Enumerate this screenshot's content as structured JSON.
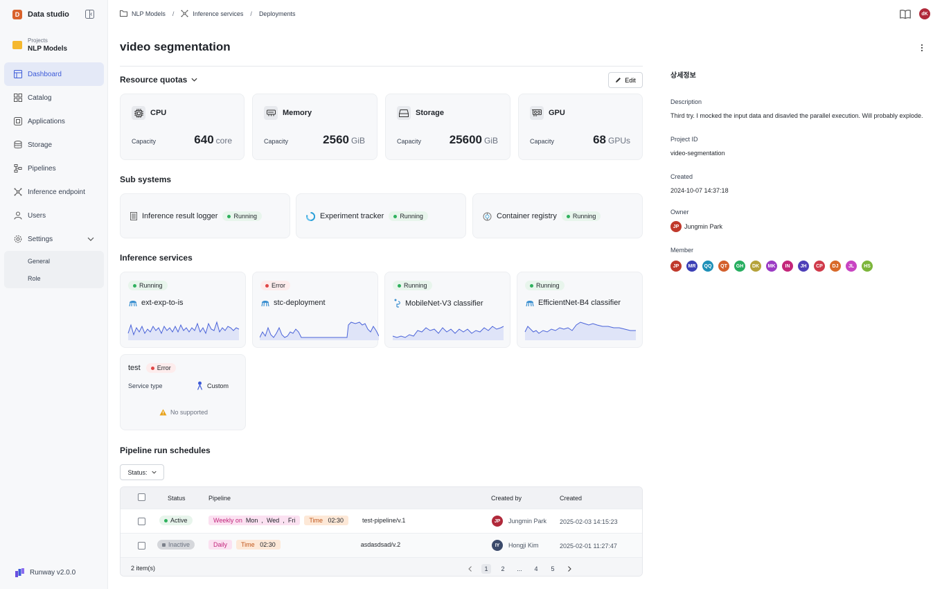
{
  "app": {
    "brand": "Data studio",
    "brand_initial": "D",
    "version": "Runway v2.0.0"
  },
  "project": {
    "sub_label": "Projects",
    "name": "NLP Models"
  },
  "nav": {
    "items": [
      {
        "label": "Dashboard",
        "icon": "dashboard-icon"
      },
      {
        "label": "Catalog",
        "icon": "catalog-icon"
      },
      {
        "label": "Applications",
        "icon": "applications-icon"
      },
      {
        "label": "Storage",
        "icon": "storage-icon"
      },
      {
        "label": "Pipelines",
        "icon": "pipelines-icon"
      },
      {
        "label": "Inference endpoint",
        "icon": "inference-icon"
      },
      {
        "label": "Users",
        "icon": "users-icon"
      },
      {
        "label": "Settings",
        "icon": "settings-icon"
      }
    ],
    "settings_sub": [
      "General",
      "Role"
    ]
  },
  "breadcrumb": [
    "NLP Models",
    "Inference services",
    "Deployments"
  ],
  "user": {
    "initials": "dK",
    "color": "#b0293a"
  },
  "page": {
    "title": "video segmentation"
  },
  "quotas": {
    "title": "Resource quotas",
    "edit_label": "Edit",
    "capacity_label": "Capacity",
    "items": [
      {
        "name": "CPU",
        "value": "640",
        "unit": "core",
        "icon": "cpu-icon"
      },
      {
        "name": "Memory",
        "value": "2560",
        "unit": "GiB",
        "icon": "memory-icon"
      },
      {
        "name": "Storage",
        "value": "25600",
        "unit": "GiB",
        "icon": "hard-drive-icon"
      },
      {
        "name": "GPU",
        "value": "68",
        "unit": "GPUs",
        "icon": "gpu-icon"
      }
    ]
  },
  "subsystems": {
    "title": "Sub systems",
    "items": [
      {
        "name": "Inference result logger",
        "status": "Running",
        "icon": "logger-icon"
      },
      {
        "name": "Experiment tracker",
        "status": "Running",
        "icon": "tracker-icon"
      },
      {
        "name": "Container registry",
        "status": "Running",
        "icon": "registry-icon"
      }
    ]
  },
  "inference": {
    "title": "Inference services",
    "items": [
      {
        "name": "ext-exp-to-is",
        "status": "Running",
        "icon": "kubeflow-icon"
      },
      {
        "name": "stc-deployment",
        "status": "Error",
        "icon": "kubeflow-icon"
      },
      {
        "name": "MobileNet-V3 classifier",
        "status": "Running",
        "icon": "model-icon"
      },
      {
        "name": "EfficientNet-B4 classifier",
        "status": "Running",
        "icon": "kubeflow-icon"
      }
    ],
    "test": {
      "name": "test",
      "status": "Error",
      "type_label": "Service type",
      "type_value": "Custom",
      "warning": "No supported"
    }
  },
  "pipelines": {
    "title": "Pipeline run schedules",
    "filter_label": "Status:",
    "columns": {
      "status": "Status",
      "pipeline": "Pipeline",
      "created_by": "Created by",
      "created": "Created"
    },
    "rows": [
      {
        "status": "Active",
        "schedule": "Weekly on",
        "days": [
          "Mon",
          "Wed",
          "Fri"
        ],
        "time_label": "Time",
        "time": "02:30",
        "pipeline": "test-pipeline/v.1",
        "user_initials": "JP",
        "user": "Jungmin Park",
        "user_color": "#b0293a",
        "created": "2025-02-03 14:15:23"
      },
      {
        "status": "Inactive",
        "schedule": "Daily",
        "days": [],
        "time_label": "Time",
        "time": "02:30",
        "pipeline": "asdasdsad/v.2",
        "user_initials": "IY",
        "user": "Hongji Kim",
        "user_color": "#3b4a6b",
        "created": "2025-02-01 11:27:47"
      }
    ],
    "count": "2 item(s)",
    "pages": [
      "1",
      "2",
      "...",
      "4",
      "5"
    ],
    "current_page": "1"
  },
  "details": {
    "title": "상세정보",
    "description_label": "Description",
    "description": "Third try. I mocked the input data and disavled the parallel execution. Will probably explode.",
    "project_id_label": "Project ID",
    "project_id": "video-segmentation",
    "created_label": "Created",
    "created": "2024-10-07 14:37:18",
    "owner_label": "Owner",
    "owner": "Jungmin Park",
    "owner_initials": "JP",
    "member_label": "Member",
    "members": [
      {
        "initials": "JP",
        "color": "#c0392b"
      },
      {
        "initials": "MR",
        "color": "#3b3fb5"
      },
      {
        "initials": "QQ",
        "color": "#1e90b8"
      },
      {
        "initials": "QT",
        "color": "#d35f2c"
      },
      {
        "initials": "GH",
        "color": "#27ae60"
      },
      {
        "initials": "DK",
        "color": "#b5a23a"
      },
      {
        "initials": "MK",
        "color": "#9b3bc4"
      },
      {
        "initials": "IN",
        "color": "#c4267a"
      },
      {
        "initials": "JH",
        "color": "#4d3fb8"
      },
      {
        "initials": "CP",
        "color": "#d03a4a"
      },
      {
        "initials": "DJ",
        "color": "#d86a2a"
      },
      {
        "initials": "JL",
        "color": "#c844c2"
      },
      {
        "initials": "HS",
        "color": "#7cb53a"
      }
    ]
  },
  "colors": {
    "accent": "#3d5bd8",
    "running": "#2fb15d",
    "error": "#e04646",
    "spark_line": "#4a63d9",
    "spark_fill": "#dfe4f8"
  }
}
